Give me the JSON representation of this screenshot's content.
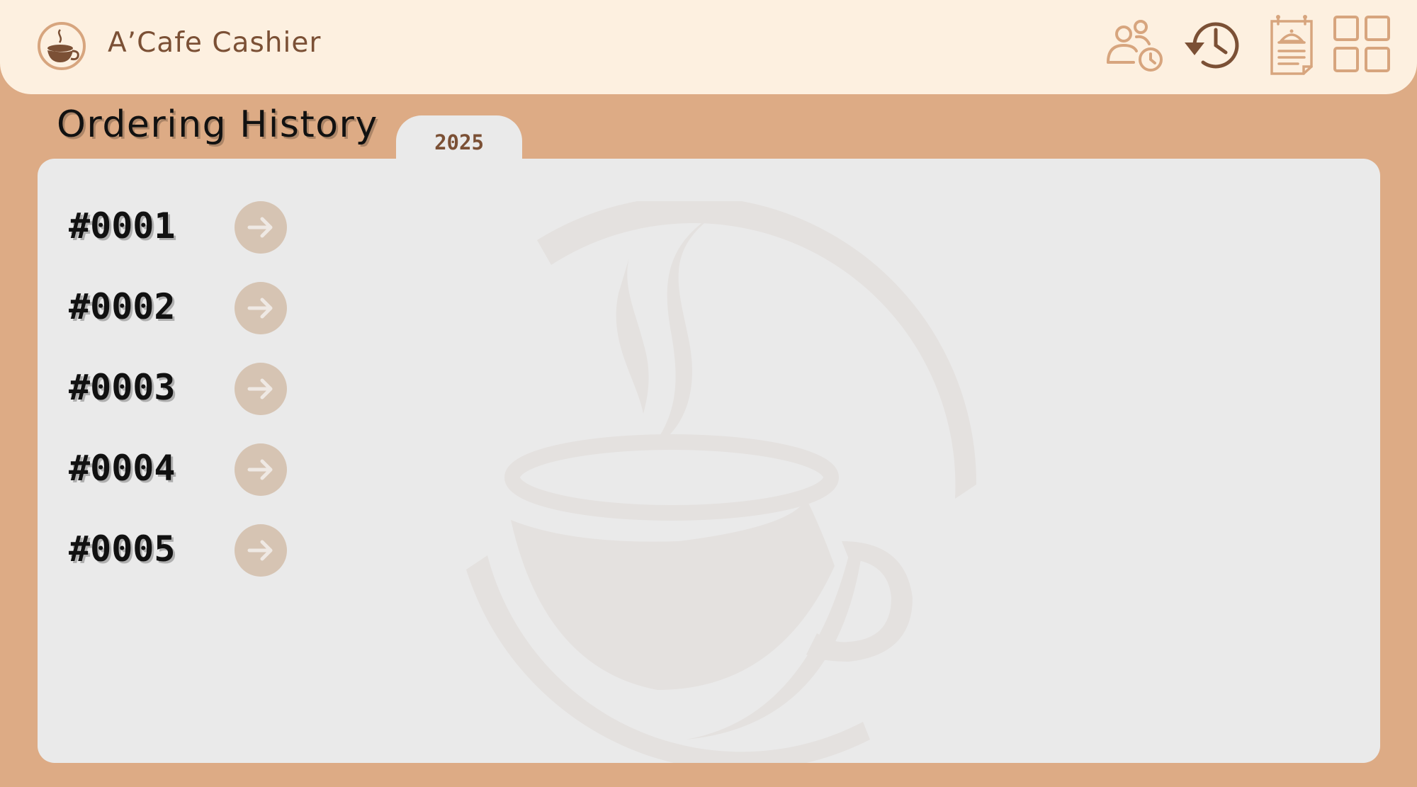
{
  "header": {
    "app_title": "A’Cafe Cashier",
    "icons": [
      "customer-history-icon",
      "history-icon",
      "menu-clipboard-icon",
      "grid-icon"
    ]
  },
  "page": {
    "title": "Ordering History",
    "year_tab": "2025"
  },
  "orders": [
    {
      "id": "#0001"
    },
    {
      "id": "#0002"
    },
    {
      "id": "#0003"
    },
    {
      "id": "#0004"
    },
    {
      "id": "#0005"
    }
  ],
  "colors": {
    "background": "#ddab85",
    "header": "#fdf0e0",
    "panel": "#eaeaea",
    "brand_brown": "#7b5035",
    "icon_tan": "#d7a57e",
    "arrow_circle": "#d6c4b3"
  }
}
